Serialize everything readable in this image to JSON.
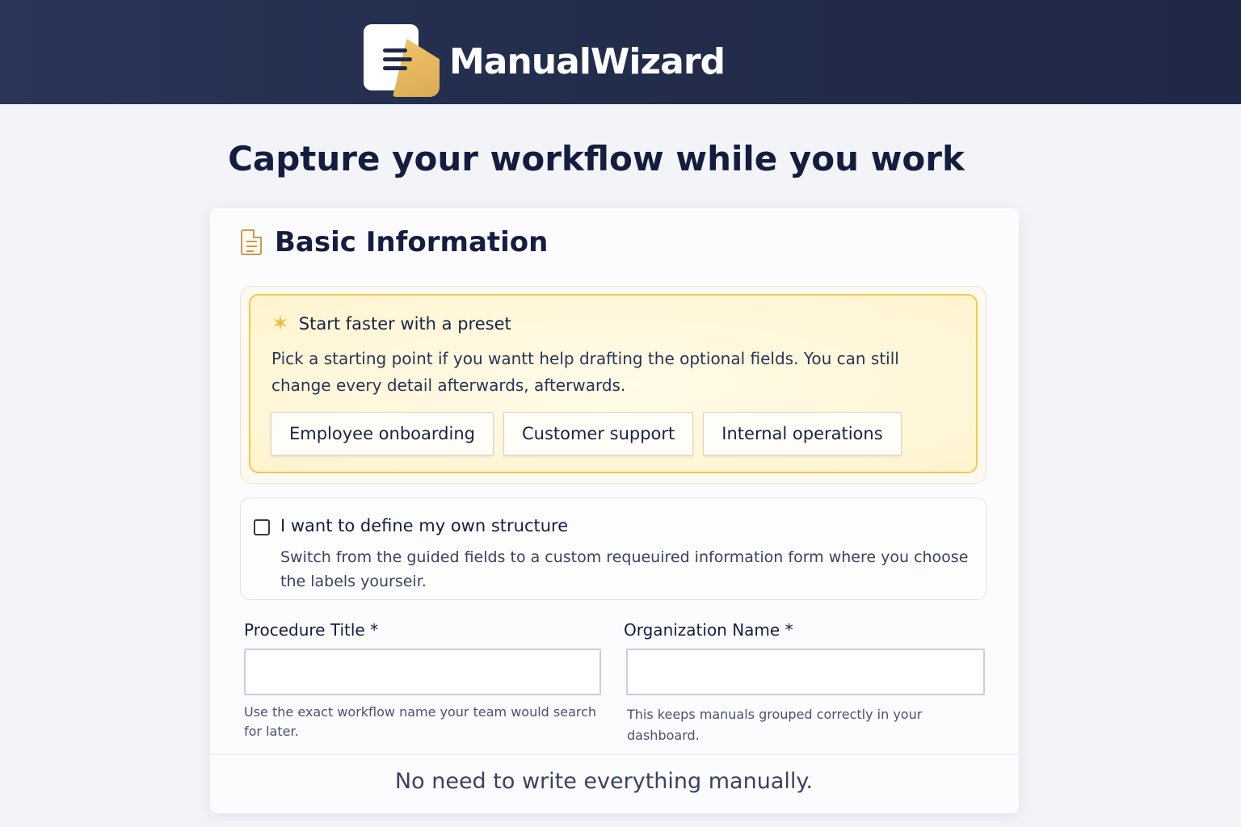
{
  "app": {
    "name": "ManualWizard",
    "logo_icon": "manual-document-icon"
  },
  "page": {
    "title": "Capture your workflow while you work"
  },
  "section": {
    "title": "Basic Information",
    "icon": "document-icon"
  },
  "preset": {
    "icon": "sparkle-icon",
    "title": "Start faster with a preset",
    "description": "Pick a starting point if you wantt help drafting the optional fields. You can still change every detail afterwards, afterwards.",
    "options": [
      {
        "label": "Employee onboarding"
      },
      {
        "label": "Customer support"
      },
      {
        "label": "Internal operations"
      }
    ]
  },
  "custom_structure": {
    "checked": false,
    "label": "I want to define my own structure",
    "description": "Switch from the guided fields to a custom requeuired information form where you choose the labels yourseir."
  },
  "fields": {
    "procedure_title": {
      "label": "Procedure Title *",
      "value": "",
      "help": "Use the exact workflow name your team would search for later."
    },
    "organization_name": {
      "label": "Organization Name *",
      "value": "",
      "help": "This keeps manuals grouped correctly in your dashboard."
    }
  },
  "footer": {
    "note": "No need to write everything manually."
  },
  "colors": {
    "header_bg": "#222c4b",
    "accent_gold": "#f3c94a",
    "text_dark": "#151e40"
  }
}
